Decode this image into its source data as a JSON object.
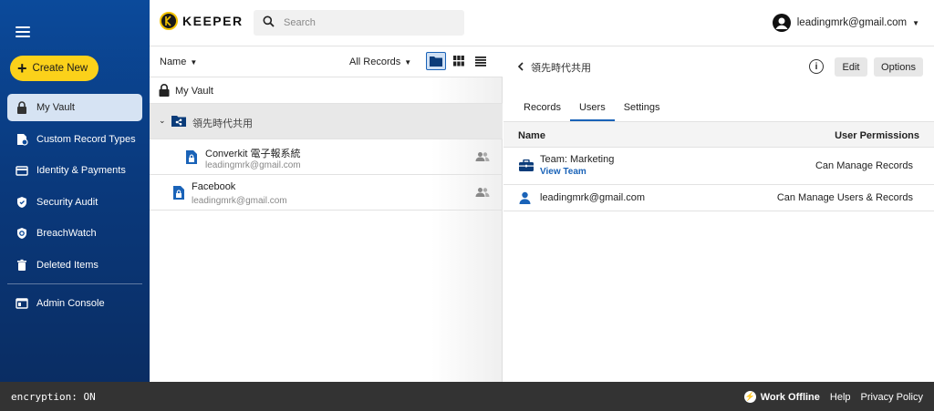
{
  "sidebar": {
    "create_label": "Create New",
    "items": [
      {
        "label": "My Vault",
        "icon": "lock-icon",
        "active": true
      },
      {
        "label": "Custom Record Types",
        "icon": "document-cog-icon"
      },
      {
        "label": "Identity & Payments",
        "icon": "credit-card-icon"
      },
      {
        "label": "Security Audit",
        "icon": "shield-icon"
      },
      {
        "label": "BreachWatch",
        "icon": "breachwatch-icon"
      },
      {
        "label": "Deleted Items",
        "icon": "trash-icon"
      },
      {
        "label": "Admin Console",
        "icon": "console-icon"
      }
    ]
  },
  "header": {
    "logo_text": "KEEPER",
    "search_placeholder": "Search",
    "account_email": "leadingmrk@gmail.com"
  },
  "list": {
    "sort_label": "Name",
    "filter_label": "All Records",
    "vault_label": "My Vault",
    "shared_folder": "領先時代共用",
    "records": [
      {
        "title": "Converkit 電子報系統",
        "subtitle": "leadingmrk@gmail.com"
      },
      {
        "title": "Facebook",
        "subtitle": "leadingmrk@gmail.com"
      }
    ]
  },
  "detail": {
    "back_label": "領先時代共用",
    "info_label": "i",
    "edit_label": "Edit",
    "options_label": "Options",
    "tabs": [
      "Records",
      "Users",
      "Settings"
    ],
    "active_tab": "Users",
    "col_name": "Name",
    "col_perm": "User Permissions",
    "users": [
      {
        "name": "Team: Marketing",
        "link": "View Team",
        "permission": "Can Manage Records",
        "icon": "team-icon"
      },
      {
        "name": "leadingmrk@gmail.com",
        "permission": "Can Manage Users & Records",
        "icon": "user-icon"
      }
    ]
  },
  "footer": {
    "encryption": "encryption: ON",
    "work_offline": "Work Offline",
    "help": "Help",
    "privacy": "Privacy Policy"
  },
  "colors": {
    "sidebar": "#0b4a9b",
    "accent": "#fbd11a",
    "link": "#1a63b8",
    "footer": "#333333"
  }
}
